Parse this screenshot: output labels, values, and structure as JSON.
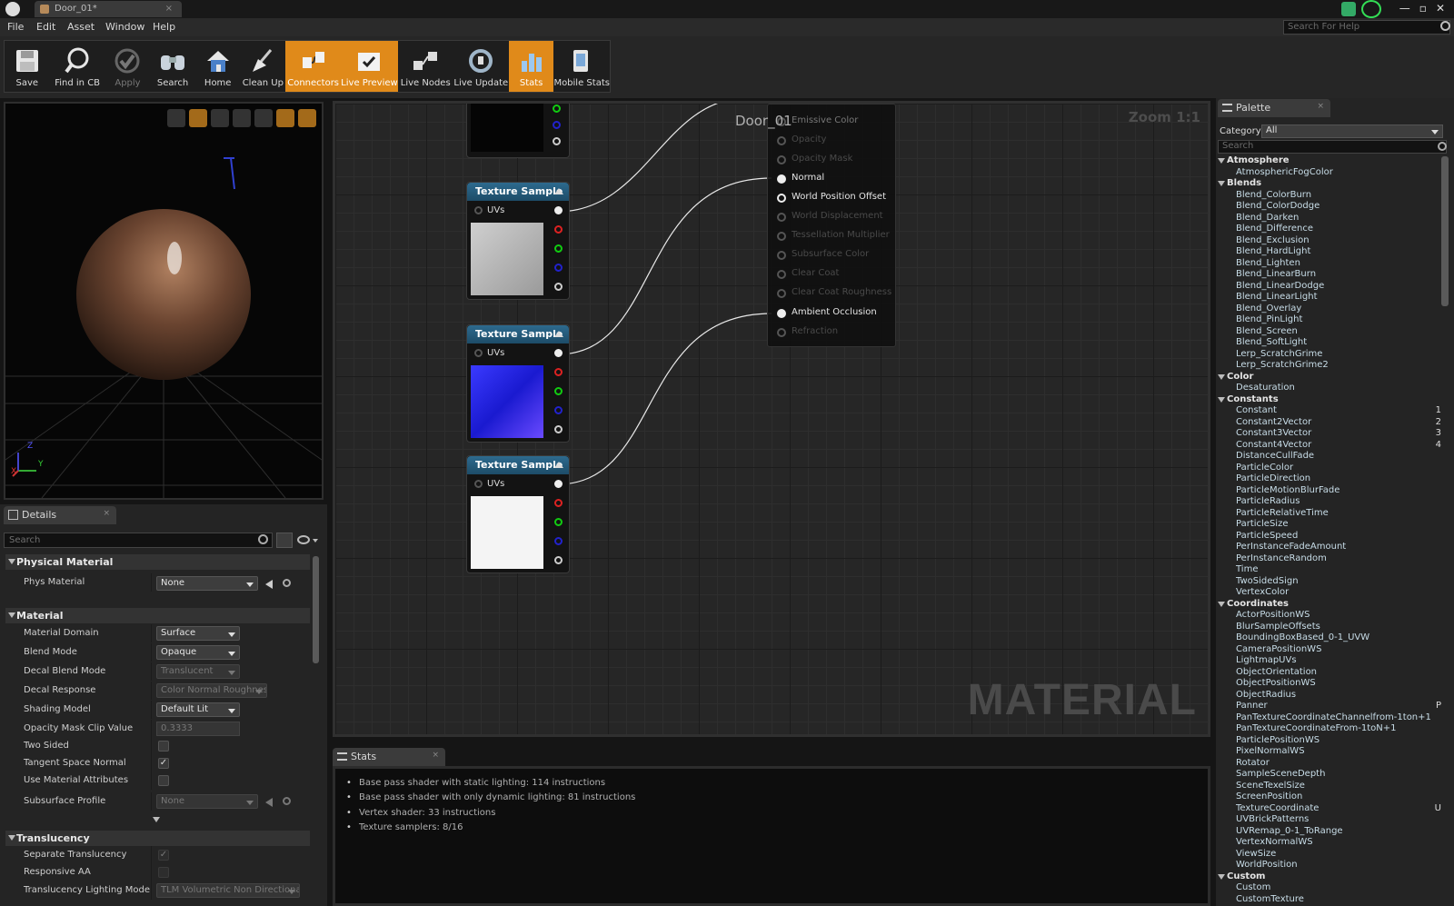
{
  "window": {
    "tab_title": "Door_01*",
    "tab_close": "×",
    "minimize": "—",
    "restore": "▫",
    "close": "✕"
  },
  "menu": [
    "File",
    "Edit",
    "Asset",
    "Window",
    "Help"
  ],
  "help_search": {
    "placeholder": "Search For Help"
  },
  "toolbar": [
    {
      "label": "Save",
      "icon": "save-icon",
      "active": false
    },
    {
      "label": "Find in CB",
      "icon": "magnifier-icon",
      "active": false
    },
    {
      "label": "Apply",
      "icon": "checkmark-icon",
      "active": false
    },
    {
      "label": "Search",
      "icon": "binoculars-icon",
      "active": false
    },
    {
      "label": "Home",
      "icon": "home-icon",
      "active": false
    },
    {
      "label": "Clean Up",
      "icon": "broom-icon",
      "active": false
    },
    {
      "label": "Connectors",
      "icon": "connectors-icon",
      "active": true
    },
    {
      "label": "Live Preview",
      "icon": "live-preview-icon",
      "active": true
    },
    {
      "label": "Live Nodes",
      "icon": "live-nodes-icon",
      "active": false
    },
    {
      "label": "Live Update",
      "icon": "live-update-icon",
      "active": false
    },
    {
      "label": "Stats",
      "icon": "stats-icon",
      "active": true
    },
    {
      "label": "Mobile Stats",
      "icon": "mobile-stats-icon",
      "active": false
    }
  ],
  "viewport": {
    "axis_x": "X",
    "axis_y": "Y",
    "axis_z": "Z"
  },
  "details": {
    "tab": "Details",
    "search_placeholder": "Search",
    "sections": {
      "physical": "Physical Material",
      "material": "Material",
      "translucency": "Translucency"
    },
    "props": {
      "phys_material": {
        "label": "Phys Material",
        "value": "None"
      },
      "material_domain": {
        "label": "Material Domain",
        "value": "Surface"
      },
      "blend_mode": {
        "label": "Blend Mode",
        "value": "Opaque"
      },
      "decal_blend_mode": {
        "label": "Decal Blend Mode",
        "value": "Translucent"
      },
      "decal_response": {
        "label": "Decal Response",
        "value": "Color Normal Roughness"
      },
      "shading_model": {
        "label": "Shading Model",
        "value": "Default Lit"
      },
      "opacity_mask_clip": {
        "label": "Opacity Mask Clip Value",
        "value": "0.3333"
      },
      "two_sided": {
        "label": "Two Sided",
        "checked": false
      },
      "tangent_space_normal": {
        "label": "Tangent Space Normal",
        "checked": true
      },
      "use_material_attributes": {
        "label": "Use Material Attributes",
        "checked": false
      },
      "subsurface_profile": {
        "label": "Subsurface Profile",
        "value": "None"
      },
      "separate_translucency": {
        "label": "Separate Translucency",
        "checked": true
      },
      "responsive_aa": {
        "label": "Responsive AA",
        "checked": false
      },
      "translucency_lighting_mode": {
        "label": "Translucency Lighting Mode",
        "value": "TLM Volumetric Non Directional"
      }
    }
  },
  "graph": {
    "zoom": "Zoom 1:1",
    "watermark": "MATERIAL",
    "material_title": "Door_01",
    "texture_nodes": [
      {
        "title": "Texture Sample",
        "uvs": "UVs"
      },
      {
        "title": "Texture Sample",
        "uvs": "UVs"
      },
      {
        "title": "Texture Sample",
        "uvs": "UVs"
      }
    ],
    "material_pins": [
      {
        "label": "Emissive Color",
        "active": false
      },
      {
        "label": "Opacity",
        "active": false
      },
      {
        "label": "Opacity Mask",
        "active": false
      },
      {
        "label": "Normal",
        "active": true,
        "connected": true
      },
      {
        "label": "World Position Offset",
        "active": true,
        "connected": false
      },
      {
        "label": "World Displacement",
        "active": false
      },
      {
        "label": "Tessellation Multiplier",
        "active": false
      },
      {
        "label": "Subsurface Color",
        "active": false
      },
      {
        "label": "Clear Coat",
        "active": false
      },
      {
        "label": "Clear Coat Roughness",
        "active": false
      },
      {
        "label": "Ambient Occlusion",
        "active": true,
        "connected": true
      },
      {
        "label": "Refraction",
        "active": false
      }
    ]
  },
  "stats": {
    "tab": "Stats",
    "lines": [
      "Base pass shader with static lighting: 114 instructions",
      "Base pass shader with only dynamic lighting: 81 instructions",
      "Vertex shader: 33 instructions",
      "Texture samplers: 8/16"
    ]
  },
  "palette": {
    "tab": "Palette",
    "category_label": "Category:",
    "category_value": "All",
    "search_placeholder": "Search",
    "groups": [
      {
        "name": "Atmosphere",
        "items": [
          {
            "n": "AtmosphericFogColor"
          }
        ]
      },
      {
        "name": "Blends",
        "items": [
          {
            "n": "Blend_ColorBurn"
          },
          {
            "n": "Blend_ColorDodge"
          },
          {
            "n": "Blend_Darken"
          },
          {
            "n": "Blend_Difference"
          },
          {
            "n": "Blend_Exclusion"
          },
          {
            "n": "Blend_HardLight"
          },
          {
            "n": "Blend_Lighten"
          },
          {
            "n": "Blend_LinearBurn"
          },
          {
            "n": "Blend_LinearDodge"
          },
          {
            "n": "Blend_LinearLight"
          },
          {
            "n": "Blend_Overlay"
          },
          {
            "n": "Blend_PinLight"
          },
          {
            "n": "Blend_Screen"
          },
          {
            "n": "Blend_SoftLight"
          },
          {
            "n": "Lerp_ScratchGrime"
          },
          {
            "n": "Lerp_ScratchGrime2"
          }
        ]
      },
      {
        "name": "Color",
        "items": [
          {
            "n": "Desaturation"
          }
        ]
      },
      {
        "name": "Constants",
        "items": [
          {
            "n": "Constant",
            "k": "1"
          },
          {
            "n": "Constant2Vector",
            "k": "2"
          },
          {
            "n": "Constant3Vector",
            "k": "3"
          },
          {
            "n": "Constant4Vector",
            "k": "4"
          },
          {
            "n": "DistanceCullFade"
          },
          {
            "n": "ParticleColor"
          },
          {
            "n": "ParticleDirection"
          },
          {
            "n": "ParticleMotionBlurFade"
          },
          {
            "n": "ParticleRadius"
          },
          {
            "n": "ParticleRelativeTime"
          },
          {
            "n": "ParticleSize"
          },
          {
            "n": "ParticleSpeed"
          },
          {
            "n": "PerInstanceFadeAmount"
          },
          {
            "n": "PerInstanceRandom"
          },
          {
            "n": "Time"
          },
          {
            "n": "TwoSidedSign"
          },
          {
            "n": "VertexColor"
          }
        ]
      },
      {
        "name": "Coordinates",
        "items": [
          {
            "n": "ActorPositionWS"
          },
          {
            "n": "BlurSampleOffsets"
          },
          {
            "n": "BoundingBoxBased_0-1_UVW"
          },
          {
            "n": "CameraPositionWS"
          },
          {
            "n": "LightmapUVs"
          },
          {
            "n": "ObjectOrientation"
          },
          {
            "n": "ObjectPositionWS"
          },
          {
            "n": "ObjectRadius"
          },
          {
            "n": "Panner",
            "k": "P"
          },
          {
            "n": "PanTextureCoordinateChannelfrom-1ton+1"
          },
          {
            "n": "PanTextureCoordinateFrom-1toN+1"
          },
          {
            "n": "ParticlePositionWS"
          },
          {
            "n": "PixelNormalWS"
          },
          {
            "n": "Rotator"
          },
          {
            "n": "SampleSceneDepth"
          },
          {
            "n": "SceneTexelSize"
          },
          {
            "n": "ScreenPosition"
          },
          {
            "n": "TextureCoordinate",
            "k": "U"
          },
          {
            "n": "UVBrickPatterns"
          },
          {
            "n": "UVRemap_0-1_ToRange"
          },
          {
            "n": "VertexNormalWS"
          },
          {
            "n": "ViewSize"
          },
          {
            "n": "WorldPosition"
          }
        ]
      },
      {
        "name": "Custom",
        "items": [
          {
            "n": "Custom"
          },
          {
            "n": "CustomTexture"
          }
        ]
      }
    ]
  }
}
